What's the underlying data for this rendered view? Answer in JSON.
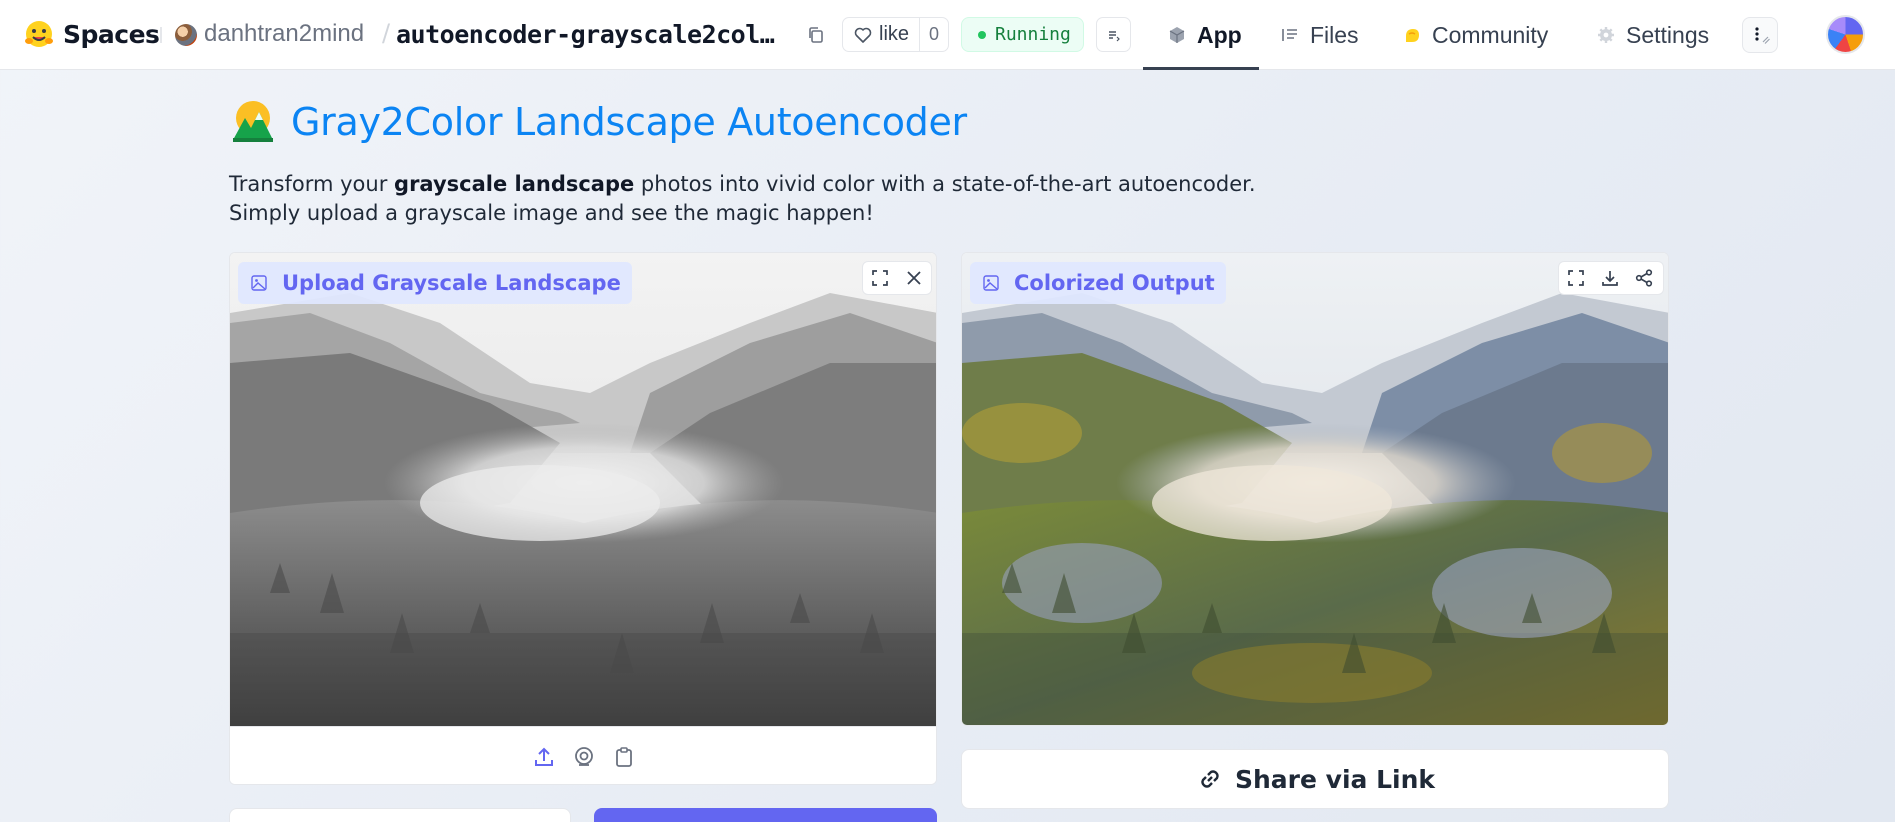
{
  "header": {
    "spaces_label": "Spaces",
    "owner": "danhtran2mind",
    "repo": "autoencoder-grayscale2col…",
    "like_label": "like",
    "like_count": "0",
    "status": "Running",
    "tabs": [
      {
        "label": "App",
        "icon": "cube-icon"
      },
      {
        "label": "Files",
        "icon": "files-icon"
      },
      {
        "label": "Community",
        "icon": "community-icon"
      },
      {
        "label": "Settings",
        "icon": "gear-icon"
      }
    ]
  },
  "main": {
    "title": "Gray2Color Landscape Autoencoder",
    "title_icon": "landscape-icon",
    "description": {
      "line1_pre": "Transform your ",
      "line1_bold": "grayscale landscape",
      "line1_post": " photos into vivid color with a state-of-the-art autoencoder.",
      "line2": "Simply upload a grayscale image and see the magic happen!"
    },
    "input_panel": {
      "label": "Upload Grayscale Landscape",
      "tools": [
        "upload-icon",
        "webcam-icon",
        "clipboard-icon"
      ],
      "actions": [
        "fullscreen-icon",
        "close-icon"
      ]
    },
    "output_panel": {
      "label": "Colorized Output",
      "actions": [
        "fullscreen-icon",
        "download-icon",
        "share-icon"
      ]
    },
    "share_button": "Share via Link"
  },
  "colors": {
    "accent": "#6366f1",
    "title": "#0b84f3",
    "running": "#22c55e"
  }
}
